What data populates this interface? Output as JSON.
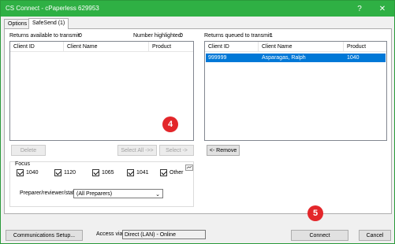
{
  "window": {
    "title": "CS Connect - cPaperless 629953",
    "controls": {
      "help": "?",
      "close": "✕"
    }
  },
  "tabs": [
    {
      "label": "Options"
    },
    {
      "label": "SafeSend (1)"
    }
  ],
  "left": {
    "available_label": "Returns available to transmit:",
    "available_count": "0",
    "highlighted_label": "Number highlighted:",
    "highlighted_count": "0",
    "columns": [
      "Client ID",
      "Client Name",
      "Product"
    ],
    "rows": []
  },
  "right": {
    "queued_label": "Returns queued to transmit:",
    "queued_count": "1",
    "columns": [
      "Client ID",
      "Client Name",
      "Product"
    ],
    "rows": [
      {
        "client_id": "999999",
        "client_name": "Asparagas, Ralph",
        "product": "1040"
      }
    ]
  },
  "buttons": {
    "delete": "Delete",
    "select_all": "Select All ->>",
    "select": "Select ->",
    "remove": "<- Remove",
    "communications": "Communications Setup...",
    "connect": "Connect",
    "cancel": "Cancel"
  },
  "focus": {
    "label": "Focus",
    "options": [
      {
        "label": "1040",
        "checked": true
      },
      {
        "label": "1120",
        "checked": true
      },
      {
        "label": "1065",
        "checked": true
      },
      {
        "label": "1041",
        "checked": true
      },
      {
        "label": "Other",
        "checked": true
      }
    ]
  },
  "preparer": {
    "label": "Preparer/reviewer/staff:",
    "value": "(All Preparers)"
  },
  "access": {
    "label": "Access via",
    "value": "Direct (LAN) - Online"
  },
  "annotations": [
    {
      "number": "4"
    },
    {
      "number": "5"
    }
  ]
}
